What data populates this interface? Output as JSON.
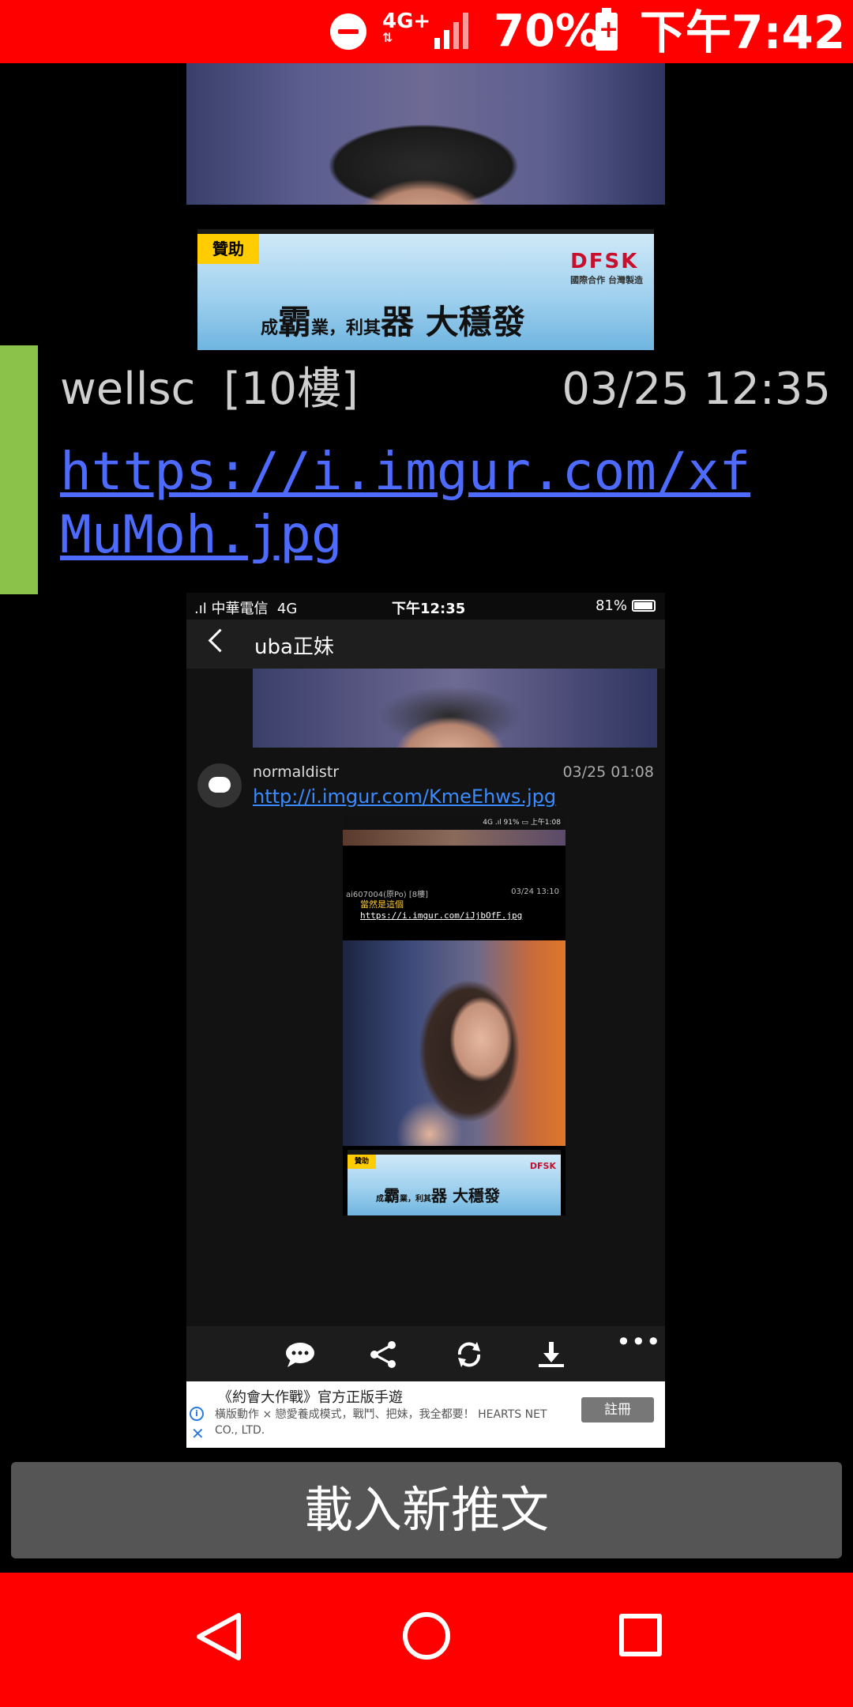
{
  "status_bar": {
    "network": "4G+",
    "battery_percent": "70%",
    "time": "下午7:42"
  },
  "sponsor_banner": {
    "tag": "贊助",
    "brand": "DFSK",
    "brand_sub": "國際合作 台灣製造",
    "slogan_1": "成",
    "slogan_2": "霸",
    "slogan_3": "業，利其",
    "slogan_4": "器",
    "slogan_5": "大穩發"
  },
  "post": {
    "author": "wellsc",
    "floor": "[10樓]",
    "timestamp": "03/25 12:35",
    "link": "https://i.imgur.com/xfMuMoh.jpg"
  },
  "embedded_screenshot": {
    "status": {
      "carrier": "中華電信",
      "network": "4G",
      "time": "下午12:35",
      "battery": "81%"
    },
    "nav_title": "uba正妹",
    "comment": {
      "user": "normaldistr",
      "date": "03/25 01:08",
      "link": "http://i.imgur.com/KmeEhws.jpg"
    },
    "inner": {
      "status": "4G .ıl 91% ▭ 上午1:08",
      "meta": "ai607004(原Po) [8樓]",
      "date": "03/24 13:10",
      "text": "當然是這個",
      "link": "https://i.imgur.com/iJjbOfF.jpg"
    },
    "ad": {
      "title": "《約會大作戰》官方正版手遊",
      "body": "橫版動作 × 戀愛養成模式，戰鬥、把妹，我全都要！ HEARTS NET CO., LTD.",
      "button": "註冊"
    }
  },
  "load_more_label": "載入新推文"
}
